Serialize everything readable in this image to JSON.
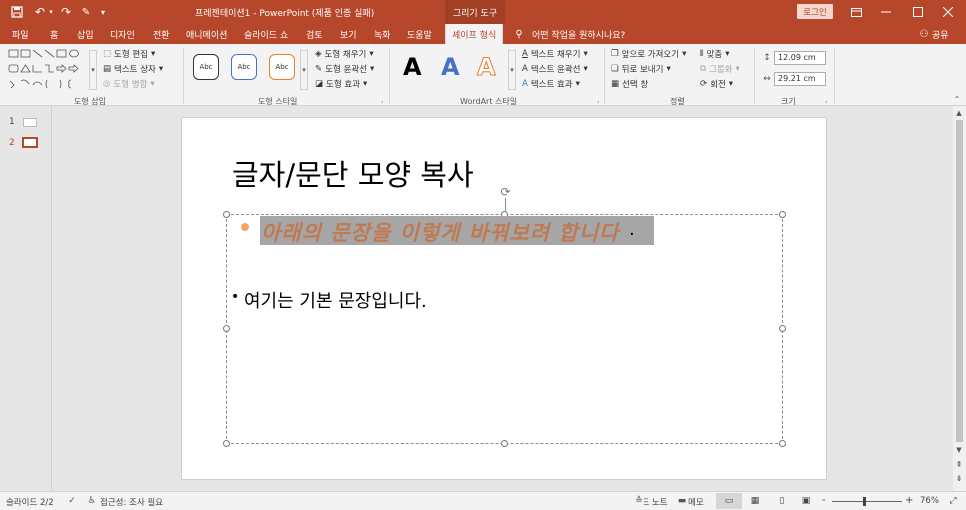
{
  "window": {
    "title": "프레젠테이션1 - PowerPoint (제품 인증 실패)",
    "context_tab_title": "그리기 도구",
    "login_label": "로그인",
    "share_label": "공유",
    "qat_customize": "▾"
  },
  "tabs": [
    "파일",
    "홈",
    "삽입",
    "디자인",
    "전환",
    "애니메이션",
    "슬라이드 쇼",
    "검토",
    "보기",
    "녹화",
    "도움말",
    "셰이프 형식"
  ],
  "tell_me": "어떤 작업을 원하시나요?",
  "ribbon": {
    "insert_shapes": {
      "label": "도형 삽입",
      "edit_shape": "도형 편집",
      "text_box": "텍스트 상자",
      "merge_shapes": "도형 병합"
    },
    "shape_styles": {
      "label": "도형 스타일",
      "presets": [
        "Abc",
        "Abc",
        "Abc"
      ],
      "fill": "도형 채우기",
      "outline": "도형 윤곽선",
      "effects": "도형 효과"
    },
    "wordart": {
      "label": "WordArt 스타일",
      "samples": [
        "A",
        "A",
        "A"
      ],
      "text_fill": "텍스트 채우기",
      "text_outline": "텍스트 윤곽선",
      "text_effects": "텍스트 효과"
    },
    "arrange": {
      "label": "정렬",
      "bring_forward": "앞으로 가져오기",
      "send_backward": "뒤로 보내기",
      "selection_pane": "선택 창",
      "align": "맞춤",
      "group": "그룹화",
      "rotate": "회전"
    },
    "size": {
      "label": "크기",
      "height": "12.09 cm",
      "width": "29.21 cm"
    }
  },
  "slides": {
    "numbers": [
      "1",
      "2"
    ],
    "current": 2
  },
  "slide": {
    "title": "글자/문단 모양 복사",
    "bullet_styled": "아래의 문장을 이렇게 바꿔보려 합니다",
    "bullet_styled_end": ".",
    "bullet_plain_marker": "•",
    "bullet_plain": "여기는 기본 문장입니다."
  },
  "status": {
    "slide_indicator": "슬라이드 2/2",
    "accessibility": "접근성: 조사 필요",
    "notes": "슬라이드 노트",
    "comments": "메모",
    "zoom": "76%",
    "zoom_minus": "-",
    "zoom_plus": "+"
  },
  "colors": {
    "accent": "#b7472a",
    "styled_text": "#c07a52",
    "highlight": "#a6a6a6",
    "bullet_orange": "#f4a460"
  }
}
